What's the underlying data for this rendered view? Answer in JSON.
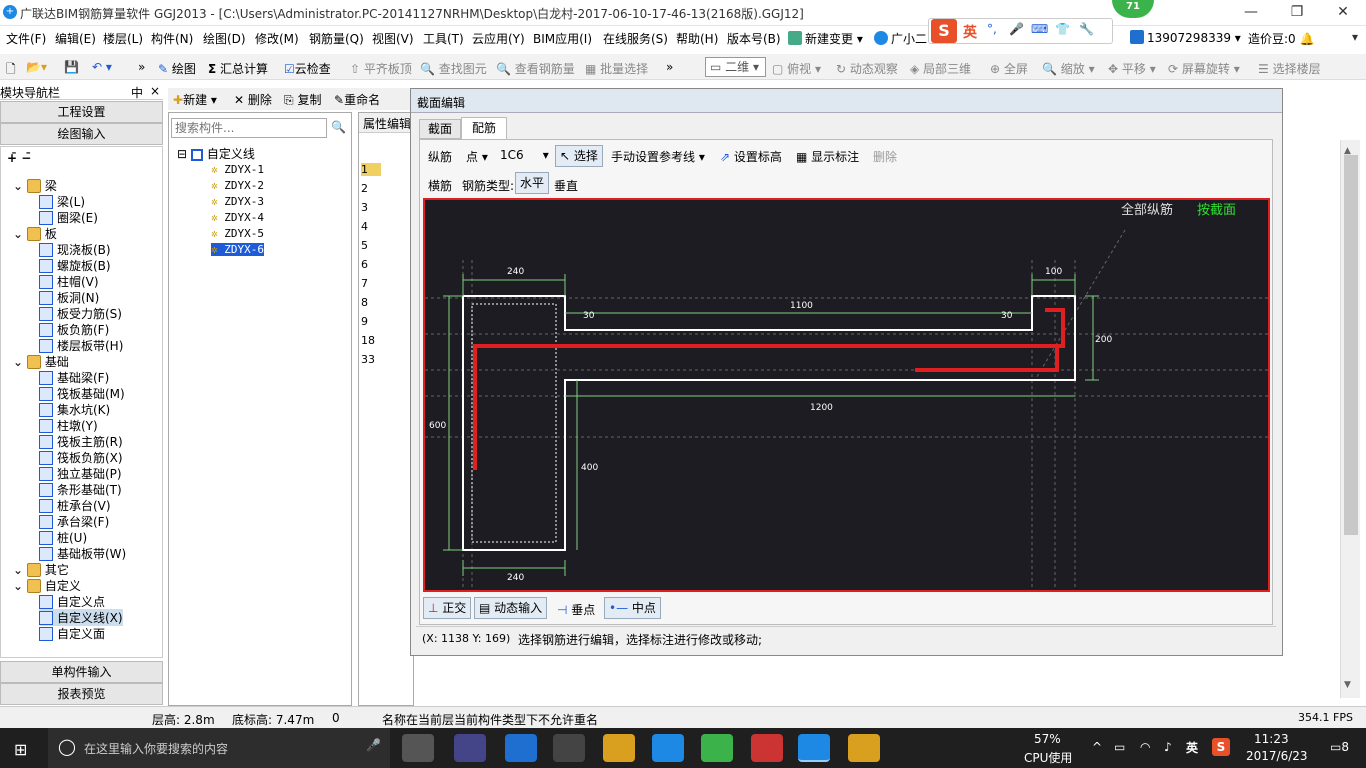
{
  "window": {
    "title": "广联达BIM钢筋算量软件 GGJ2013 - [C:\\Users\\Administrator.PC-20141127NRHM\\Desktop\\白龙村-2017-06-10-17-46-13(2168版).GGJ12]",
    "badge": "71"
  },
  "menu": [
    "文件(F)",
    "编辑(E)",
    "楼层(L)",
    "构件(N)",
    "绘图(D)",
    "修改(M)",
    "钢筋量(Q)",
    "视图(V)",
    "工具(T)",
    "云应用(Y)",
    "BIM应用(I)",
    "在线服务(S)",
    "帮助(H)",
    "版本号(B)",
    "新建变更",
    "广小二"
  ],
  "ime": {
    "label": "英"
  },
  "user": {
    "phone": "13907298339",
    "price": "造价豆:0"
  },
  "toolbar": [
    "绘图",
    "汇总计算",
    "云检查",
    "平齐板顶",
    "查找图元",
    "查看钢筋量",
    "批量选择",
    "二维",
    "俯视",
    "动态观察",
    "局部三维",
    "全屏",
    "缩放",
    "平移",
    "屏幕旋转",
    "选择楼层"
  ],
  "nav": {
    "title": "模块导航栏",
    "pin": "中",
    "close": "×",
    "project": "工程设置",
    "draw": "绘图输入",
    "single": "单构件输入",
    "report": "报表预览"
  },
  "tree": [
    {
      "label": "梁",
      "type": "folder"
    },
    {
      "label": "梁(L)",
      "type": "item"
    },
    {
      "label": "圈梁(E)",
      "type": "item"
    },
    {
      "label": "板",
      "type": "folder"
    },
    {
      "label": "现浇板(B)",
      "type": "item"
    },
    {
      "label": "螺旋板(B)",
      "type": "item"
    },
    {
      "label": "柱帽(V)",
      "type": "item"
    },
    {
      "label": "板洞(N)",
      "type": "item"
    },
    {
      "label": "板受力筋(S)",
      "type": "item"
    },
    {
      "label": "板负筋(F)",
      "type": "item"
    },
    {
      "label": "楼层板带(H)",
      "type": "item"
    },
    {
      "label": "基础",
      "type": "folder"
    },
    {
      "label": "基础梁(F)",
      "type": "item"
    },
    {
      "label": "筏板基础(M)",
      "type": "item"
    },
    {
      "label": "集水坑(K)",
      "type": "item"
    },
    {
      "label": "柱墩(Y)",
      "type": "item"
    },
    {
      "label": "筏板主筋(R)",
      "type": "item"
    },
    {
      "label": "筏板负筋(X)",
      "type": "item"
    },
    {
      "label": "独立基础(P)",
      "type": "item"
    },
    {
      "label": "条形基础(T)",
      "type": "item"
    },
    {
      "label": "桩承台(V)",
      "type": "item"
    },
    {
      "label": "承台梁(F)",
      "type": "item"
    },
    {
      "label": "桩(U)",
      "type": "item"
    },
    {
      "label": "基础板带(W)",
      "type": "item"
    },
    {
      "label": "其它",
      "type": "folder"
    },
    {
      "label": "自定义",
      "type": "folder"
    },
    {
      "label": "自定义点",
      "type": "item"
    },
    {
      "label": "自定义线(X)",
      "type": "item"
    },
    {
      "label": "自定义面",
      "type": "item"
    }
  ],
  "comp": {
    "toolbar": [
      "新建",
      "删除",
      "复制",
      "重命名"
    ],
    "search_placeholder": "搜索构件...",
    "root": "自定义线",
    "items": [
      "ZDYX-1",
      "ZDYX-2",
      "ZDYX-3",
      "ZDYX-4",
      "ZDYX-5",
      "ZDYX-6"
    ]
  },
  "props": {
    "title": "属性编辑",
    "rows": [
      "1",
      "2",
      "3",
      "4",
      "5",
      "6",
      "7",
      "8",
      "9",
      "18",
      "33"
    ]
  },
  "dialog": {
    "title": "截面编辑",
    "tabs": [
      "截面",
      "配筋"
    ],
    "row1": {
      "label": "纵筋",
      "mode": "点",
      "spec": "1C6",
      "select": "选择",
      "ref": "手动设置参考线",
      "height": "设置标高",
      "show": "显示标注",
      "del": "删除"
    },
    "row2": {
      "label": "横筋",
      "type_label": "钢筋类型:",
      "h": "水平",
      "v": "垂直"
    },
    "canvas_labels": {
      "all": "全部纵筋",
      "by": "按截面"
    },
    "dims": {
      "top_left": "240",
      "top_right": "100",
      "mid": "1100",
      "c1": "30",
      "c2": "30",
      "right": "200",
      "bottom_len": "1200",
      "left": "600",
      "inner": "400",
      "bottom": "240"
    },
    "bottom": [
      "正交",
      "动态输入",
      "垂点",
      "中点"
    ],
    "coords": "(X: 1138 Y: 169)",
    "hint": "选择钢筋进行编辑，选择标注进行修改或移动;"
  },
  "status": {
    "floor_height": "层高: 2.8m",
    "base_height": "底标高: 7.47m",
    "zero": "0",
    "msg": "名称在当前层当前构件类型下不允许重名",
    "fps": "354.1 FPS"
  },
  "taskbar": {
    "search": "在这里输入你要搜索的内容",
    "cpu_pct": "57%",
    "cpu": "CPU使用",
    "lang": "英",
    "time": "11:23",
    "date": "2017/6/23",
    "notif": "8"
  }
}
